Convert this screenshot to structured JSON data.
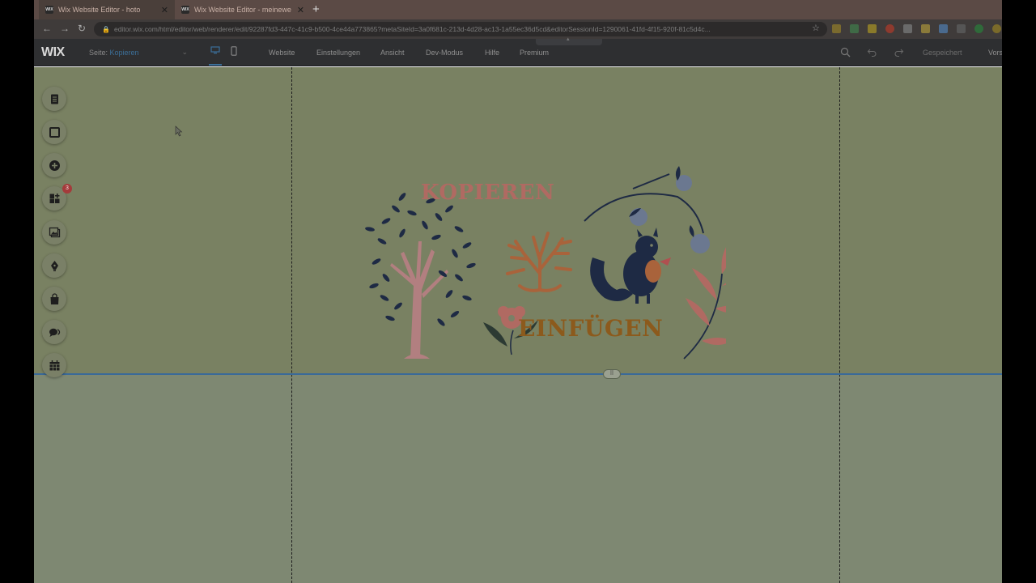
{
  "browser": {
    "tabs": [
      {
        "title": "Wix Website Editor - hoto",
        "favicon": "WIX"
      },
      {
        "title": "Wix Website Editor - meinewe",
        "favicon": "WIX"
      }
    ],
    "new_tab": "+",
    "url": "editor.wix.com/html/editor/web/renderer/edit/92287fd3-447c-41c9-b500-4ce44a773865?metaSiteId=3a0f681c-213d-4d28-ac13-1a55ec36d5cd&editorSessionId=1290061-41fd-4f15-920f-81c5d4c..."
  },
  "wix": {
    "logo": "WIX",
    "page_label": "Seite:",
    "page_value": "Kopieren",
    "menu": [
      "Website",
      "Einstellungen",
      "Ansicht",
      "Dev-Modus",
      "Hilfe",
      "Premium"
    ],
    "saved": "Gespeichert",
    "preview": "Vors"
  },
  "rail": {
    "items": [
      "pages-icon",
      "background-icon",
      "add-icon",
      "apps-icon",
      "media-icon",
      "blog-icon",
      "store-icon",
      "chat-icon",
      "bookings-icon"
    ],
    "apps_badge": "3"
  },
  "artwork": {
    "line1": "KOPIEREN",
    "line2": "EINFÜGEN"
  },
  "colors": {
    "canvas": "#798162",
    "accent": "#3a6a99",
    "text_top": "#b06a62",
    "text_bottom": "#8c5a1c"
  }
}
